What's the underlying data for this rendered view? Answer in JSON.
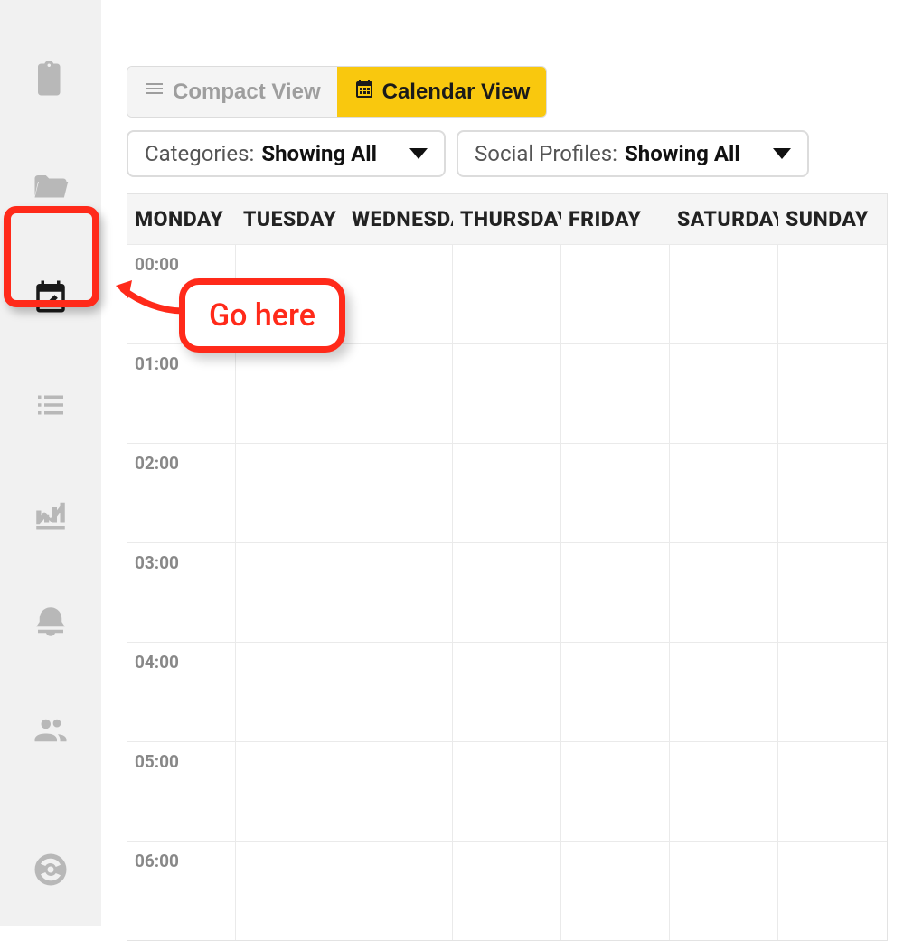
{
  "views": {
    "compact": "Compact View",
    "calendar": "Calendar View"
  },
  "filters": {
    "categories_label": "Categories:",
    "categories_value": "Showing All",
    "profiles_label": "Social Profiles:",
    "profiles_value": "Showing All"
  },
  "calendar": {
    "days": [
      "MONDAY",
      "TUESDAY",
      "WEDNESDAY",
      "THURSDAY",
      "FRIDAY",
      "SATURDAY",
      "SUNDAY"
    ],
    "times": [
      "00:00",
      "01:00",
      "02:00",
      "03:00",
      "04:00",
      "05:00",
      "06:00"
    ]
  },
  "annotation": {
    "callout_text": "Go here",
    "color": "#ff2a1a"
  },
  "sidebar": {
    "items": [
      "clipboard",
      "folder",
      "calendar-edit",
      "list",
      "analytics",
      "bell",
      "users",
      "help"
    ],
    "active": "calendar-edit"
  }
}
